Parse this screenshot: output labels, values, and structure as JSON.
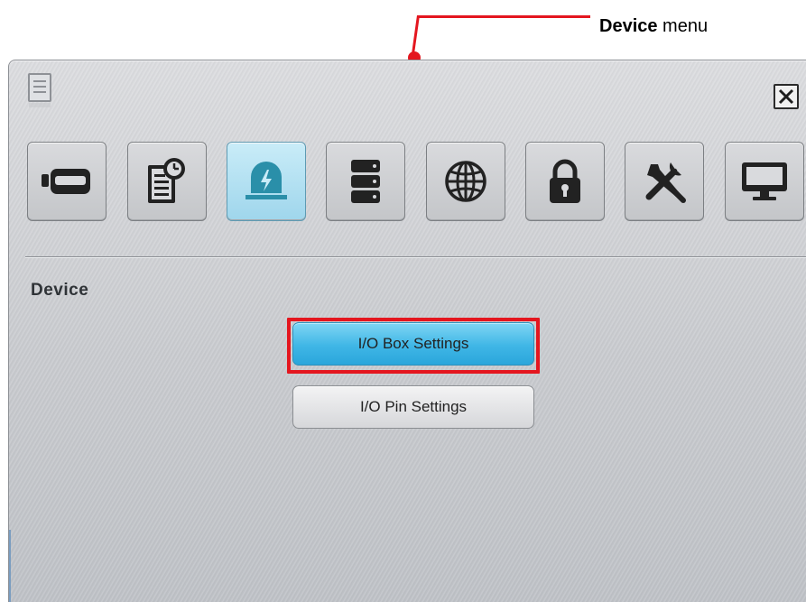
{
  "callout": {
    "label_bold": "Device",
    "label_rest": " menu"
  },
  "window": {
    "section_title": "Device",
    "close_icon": "close-icon",
    "menu_icon": "document-icon"
  },
  "tabs": [
    {
      "icon": "camera-icon",
      "active": false
    },
    {
      "icon": "schedule-icon",
      "active": false
    },
    {
      "icon": "alarm-icon",
      "active": true
    },
    {
      "icon": "storage-icon",
      "active": false
    },
    {
      "icon": "network-icon",
      "active": false
    },
    {
      "icon": "lock-icon",
      "active": false
    },
    {
      "icon": "tools-icon",
      "active": false
    },
    {
      "icon": "monitor-icon",
      "active": false
    }
  ],
  "buttons": {
    "io_box": "I/O Box Settings",
    "io_pin": "I/O Pin Settings"
  },
  "colors": {
    "highlight": "#e4161f",
    "active_tab": "#9fd6ec",
    "primary_button": "#3fb6e6"
  }
}
